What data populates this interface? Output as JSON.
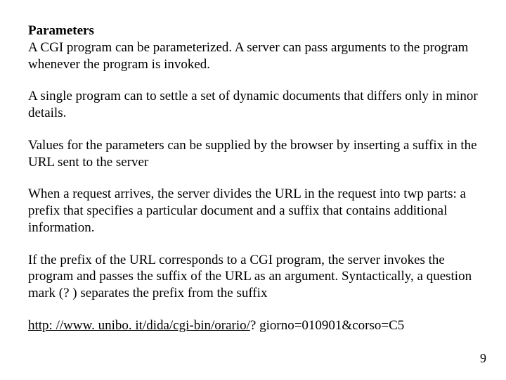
{
  "heading": "Parameters",
  "p1": "A CGI program can be parameterized. A server can pass arguments to the program whenever the program is invoked.",
  "p2": "A single program can to settle a set of dynamic documents that differs only in minor details.",
  "p3": "Values for the parameters can be supplied by the browser by inserting a suffix in the URL sent to the server",
  "p4": "When a request arrives, the server divides the URL in the request into twp parts: a prefix that specifies a particular document and a suffix that contains additional information.",
  "p5": "If the prefix of the URL corresponds to a CGI program, the server invokes the program and passes the suffix of the URL as an argument. Syntactically, a question mark (? ) separates the prefix from the suffix",
  "url_link": "http: //www. unibo. it/dida/cgi-bin/orario/",
  "url_tail": "? giorno=010901&corso=C5",
  "page_number": "9"
}
